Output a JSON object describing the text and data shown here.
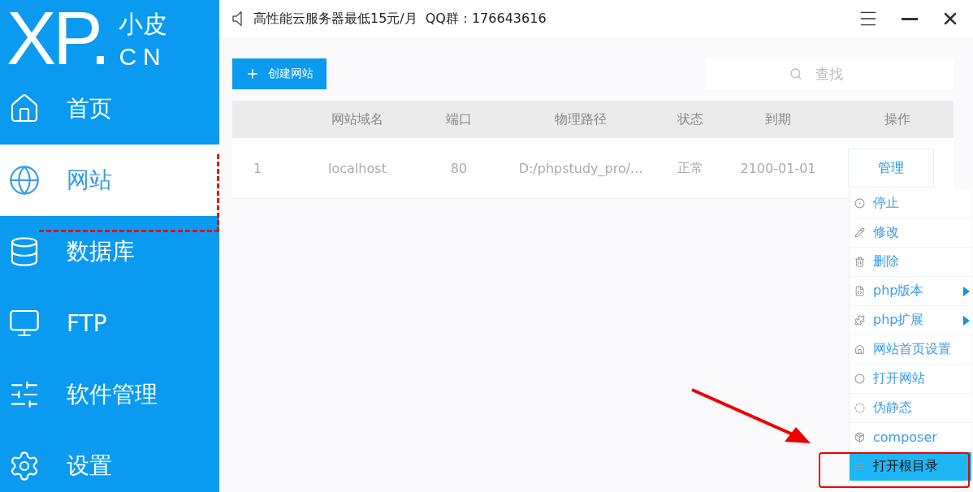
{
  "logo": {
    "mark": "XP.",
    "name_top": "小皮",
    "name_bottom": "CN"
  },
  "sidebar": {
    "items": [
      {
        "label": "首页",
        "selected": false
      },
      {
        "label": "网站",
        "selected": true
      },
      {
        "label": "数据库",
        "selected": false
      },
      {
        "label": "FTP",
        "selected": false
      },
      {
        "label": "软件管理",
        "selected": false
      },
      {
        "label": "设置",
        "selected": false
      }
    ]
  },
  "title_bar": {
    "notice": "高性能云服务器最低15元/月",
    "qq": "QQ群：176643616"
  },
  "toolbar": {
    "create_button": "创建网站",
    "search": {
      "placeholder": "查找"
    }
  },
  "table": {
    "columns": [
      "",
      "网站域名",
      "端口",
      "物理路径",
      "状态",
      "到期",
      "操作"
    ],
    "rows": [
      {
        "cells": [
          "1",
          "localhost",
          "80",
          "D:/phpstudy_pro/...",
          "正常",
          "2100-01-01"
        ],
        "action": "管理"
      }
    ]
  },
  "context_menu": {
    "items": [
      {
        "label": "停止",
        "submenu": false,
        "selected": false
      },
      {
        "label": "修改",
        "submenu": false,
        "selected": false
      },
      {
        "label": "删除",
        "submenu": false,
        "selected": false
      },
      {
        "label": "php版本",
        "submenu": true,
        "selected": false
      },
      {
        "label": "php扩展",
        "submenu": true,
        "selected": false
      },
      {
        "label": "网站首页设置",
        "submenu": false,
        "selected": false
      },
      {
        "label": "打开网站",
        "submenu": false,
        "selected": false
      },
      {
        "label": "伪静态",
        "submenu": false,
        "selected": false
      },
      {
        "label": "composer",
        "submenu": false,
        "selected": false
      },
      {
        "label": "打开根目录",
        "submenu": false,
        "selected": true
      }
    ]
  }
}
